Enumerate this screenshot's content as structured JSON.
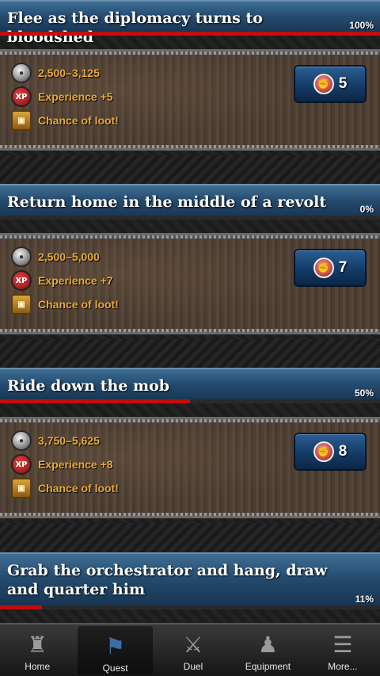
{
  "quests": [
    {
      "title": "Flee as the diplomacy turns to bloodshed",
      "percent_label": "100%",
      "progress": 1.0,
      "rewards": {
        "silver": "2,500–3,125",
        "experience": "Experience +5",
        "loot": "Chance of loot!"
      },
      "energy": "5"
    },
    {
      "title": "Return home in the middle of a revolt",
      "percent_label": "0%",
      "progress": 0.0,
      "rewards": {
        "silver": "2,500–5,000",
        "experience": "Experience +7",
        "loot": "Chance of loot!"
      },
      "energy": "7"
    },
    {
      "title": "Ride down the mob",
      "percent_label": "50%",
      "progress": 0.5,
      "rewards": {
        "silver": "3,750–5,625",
        "experience": "Experience +8",
        "loot": "Chance of loot!"
      },
      "energy": "8"
    },
    {
      "title": "Grab the orchestrator and hang, draw and quarter him",
      "percent_label": "11%",
      "progress": 0.11
    }
  ],
  "icons": {
    "silver": "silver-coin-icon",
    "xp": "xp-badge-icon",
    "xp_text": "XP",
    "loot": "treasure-chest-icon",
    "energy": "flexed-arm-icon"
  },
  "tabs": [
    {
      "label": "Home",
      "icon": "castle-icon",
      "active": false
    },
    {
      "label": "Quest",
      "icon": "flag-icon",
      "active": true
    },
    {
      "label": "Duel",
      "icon": "crossed-swords-icon",
      "active": false
    },
    {
      "label": "Equipment",
      "icon": "helmet-icon",
      "active": false
    },
    {
      "label": "More...",
      "icon": "list-icon",
      "active": false
    }
  ],
  "colors": {
    "progress": "#c40d0d",
    "header": "#244a6d",
    "reward_text": "#e8a838"
  }
}
